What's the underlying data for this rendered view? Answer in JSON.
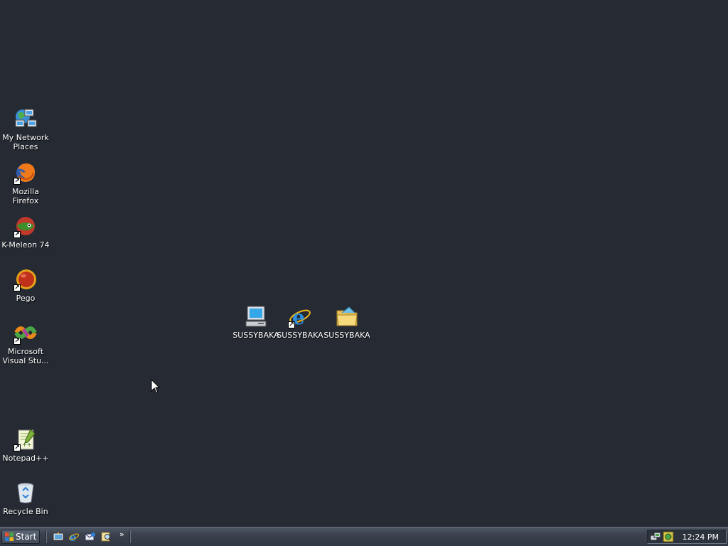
{
  "desktop": {
    "left_icons": [
      {
        "label": "My Network Places",
        "icon": "network-places-icon",
        "shortcut": false
      },
      {
        "label": "Mozilla Firefox",
        "icon": "firefox-icon",
        "shortcut": true
      },
      {
        "label": "K-Meleon 74",
        "icon": "k-meleon-icon",
        "shortcut": true
      },
      {
        "label": "Pego",
        "icon": "pego-icon",
        "shortcut": true
      },
      {
        "label": "Microsoft Visual Stu...",
        "icon": "visual-studio-icon",
        "shortcut": true
      },
      {
        "label": "Notepad++",
        "icon": "notepad-plus-plus-icon",
        "shortcut": true
      },
      {
        "label": "Recycle Bin",
        "icon": "recycle-bin-icon",
        "shortcut": false
      }
    ],
    "center_icons": [
      {
        "label": "SUSSYBAKA",
        "icon": "my-computer-icon",
        "shortcut": false
      },
      {
        "label": "SUSSYBAKA",
        "icon": "internet-explorer-icon",
        "shortcut": true
      },
      {
        "label": "SUSSYBAKA",
        "icon": "folder-icon",
        "shortcut": false
      }
    ],
    "background_color": "#252a33"
  },
  "taskbar": {
    "start_label": "Start",
    "quick_launch": [
      "show-desktop-icon",
      "internet-explorer-icon",
      "outlook-express-icon",
      "search-icon"
    ],
    "overflow_label": "»",
    "tray_icons": [
      "network-icon",
      "security-icon"
    ],
    "clock": "12:24 PM"
  }
}
